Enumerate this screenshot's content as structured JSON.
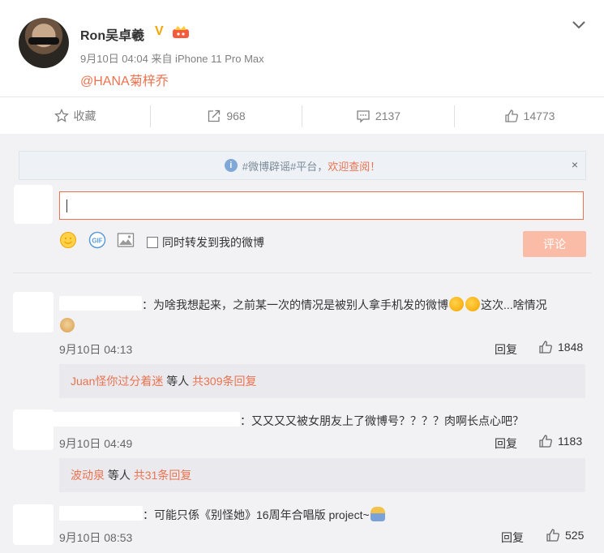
{
  "post": {
    "author": "Ron吴卓羲",
    "verified_badge": "V",
    "meta": "9月10日 04:04 来自 iPhone 11 Pro Max",
    "mention": "@HANA菊梓乔"
  },
  "actions": {
    "favorite": "收藏",
    "forward": "968",
    "comment": "2137",
    "like": "14773"
  },
  "notice": {
    "prefix": "#微博辟谣#平台，",
    "link": "欢迎查阅！",
    "close": "×"
  },
  "compose": {
    "forward_label": "同时转发到我的微博",
    "submit_label": "评论",
    "gif_label": "GIF"
  },
  "comments": [
    {
      "text": "：为啥我想起来，之前某一次的情况是被别人拿手机发的微博",
      "text_after": "这次...啥情况",
      "time": "9月10日 04:13",
      "reply": "回复",
      "likes": "1848",
      "sub_user": "Juan怪你过分着迷",
      "sub_mid": " 等人 ",
      "sub_count": "共309条回复"
    },
    {
      "text": "：又又又又被女朋友上了微博号？？？？肉啊长点心吧？",
      "time": "9月10日 04:49",
      "reply": "回复",
      "likes": "1183",
      "sub_user": "波动泉",
      "sub_mid": " 等人 ",
      "sub_count": "共31条回复"
    },
    {
      "text": "：可能只係《别怪她》16周年合唱版 project~",
      "time": "9月10日 08:53",
      "reply": "回复",
      "likes": "525"
    }
  ],
  "colors": {
    "accent": "#eb7350",
    "panel": "#f2f2f5",
    "submit_disabled": "#fbbca7"
  }
}
